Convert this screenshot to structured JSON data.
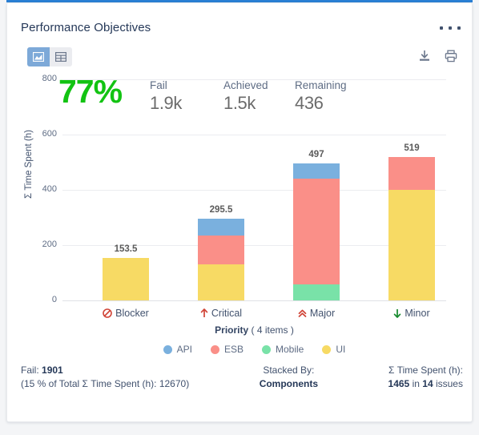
{
  "card": {
    "title": "Performance Objectives",
    "more_menu": "more-options"
  },
  "toolbar": {
    "view_chart_label": "chart-view",
    "view_table_label": "table-view",
    "download_label": "download",
    "print_label": "print"
  },
  "kpi": {
    "percent": "77%",
    "items": [
      {
        "label": "Fail",
        "value": "1.9k"
      },
      {
        "label": "Achieved",
        "value": "1.5k"
      },
      {
        "label": "Remaining",
        "value": "436"
      }
    ]
  },
  "chart_data": {
    "type": "bar",
    "stacked": true,
    "title": "Performance Objectives",
    "xlabel": "Priority",
    "xlabel_suffix": "( 4 items )",
    "ylabel": "Σ Time Spent (h)",
    "ylim": [
      0,
      800
    ],
    "yticks": [
      "0",
      "200",
      "400",
      "600",
      "800"
    ],
    "grid": true,
    "legend_position": "bottom",
    "categories": [
      "Blocker",
      "Critical",
      "Major",
      "Minor"
    ],
    "category_icons": [
      "blocker-icon",
      "critical-icon",
      "major-icon",
      "minor-icon"
    ],
    "category_icon_colors": [
      "#d04437",
      "#d04437",
      "#d04437",
      "#14892c"
    ],
    "series": [
      {
        "name": "API",
        "color": "#7ab0de",
        "values": [
          0,
          60,
          57,
          0
        ]
      },
      {
        "name": "ESB",
        "color": "#fa8f88",
        "values": [
          0,
          105,
          383,
          119
        ]
      },
      {
        "name": "Mobile",
        "color": "#79e2a8",
        "values": [
          0,
          0,
          57,
          0
        ]
      },
      {
        "name": "UI",
        "color": "#f7da64",
        "values": [
          153.5,
          130.5,
          0,
          400
        ]
      }
    ],
    "totals": [
      "153.5",
      "295.5",
      "497",
      "519"
    ]
  },
  "footer": {
    "left_line1_label": "Fail:",
    "left_line1_value": "1901",
    "left_line2": "(15 % of Total Σ Time Spent (h): 12670)",
    "center_line1": "Stacked By:",
    "center_line2": "Components",
    "right_line1": "Σ Time Spent (h):",
    "right_value1": "1465",
    "right_mid": "in",
    "right_value2": "14",
    "right_tail": "issues"
  },
  "colors": {
    "accent": "#2a7fd4",
    "success": "#12c312",
    "api": "#7ab0de",
    "esb": "#fa8f88",
    "mobile": "#79e2a8",
    "ui": "#f7da64"
  }
}
